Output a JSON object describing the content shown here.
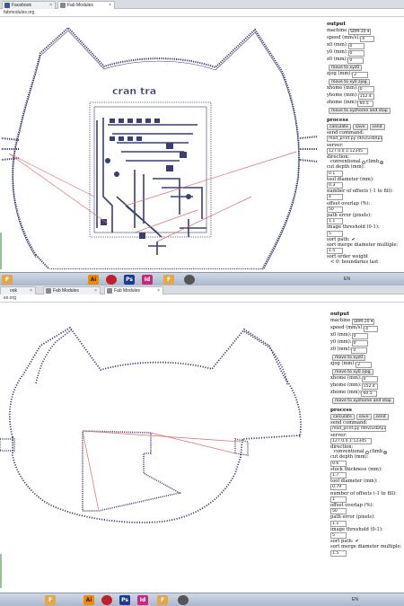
{
  "top": {
    "tabs": [
      {
        "label": "Facebook",
        "active": false
      },
      {
        "label": "Fab Modules",
        "active": true
      }
    ],
    "address": "fabmodules.org",
    "logo_text": "cran tra",
    "panel": {
      "output": "output",
      "machine_label": "machine",
      "machine_value": "SRM-20",
      "speed_label": "speed (mm/s):",
      "speed_value": "4",
      "x0_label": "x0 (mm):",
      "x0_value": "0",
      "y0_label": "y0 (mm):",
      "y0_value": "0",
      "z0_label": "z0 (mm):",
      "z0_value": "0",
      "move_xyz0": "move to xyz0",
      "zjog_label": "zjog (mm):",
      "zjog_value": "2",
      "move_xyzjog": "move to xy0 zjog",
      "xhome_label": "xhome (mm):",
      "xhome_value": "0",
      "yhome_label": "yhome (mm):",
      "yhome_value": "152.4",
      "zhome_label": "zhome (mm):",
      "zhome_value": "60.5",
      "move_home": "move to xyzhome and stop",
      "process": "process",
      "calculate": "calculate",
      "save": "save",
      "send": "send",
      "send_cmd_label": "send command:",
      "send_cmd_value": "mod_print.py /dev/usb/lp1 ;",
      "server_label": "server:",
      "server_value": "127.0.0.1:12345",
      "direction_label": "direction:",
      "conventional": "conventional",
      "climb": "climb",
      "cut_depth_label": "cut depth (mm):",
      "cut_depth_value": "0.1",
      "tool_dia_label": "tool diameter (mm):",
      "tool_dia_value": "0.3",
      "offsets_label": "number of offsets (-1 to fill):",
      "offsets_value": "4",
      "overlap_label": "offset overlap (%):",
      "overlap_value": "50",
      "path_err_label": "path error (pixels):",
      "path_err_value": "1.1",
      "threshold_label": "image threshold (0-1):",
      "threshold_value": "5",
      "sort_path": "sort path:",
      "sort_merge_label": "sort merge diameter multiple:",
      "sort_merge_value": "1.5",
      "sort_order_label": "sort order weight",
      "sort_order_note": "< 0: boundaries last"
    }
  },
  "bottom": {
    "tabs": [
      {
        "label": "ook",
        "active": false
      },
      {
        "label": "Fab Modules",
        "active": false
      },
      {
        "label": "Fab Modules",
        "active": true
      }
    ],
    "address": "es.org",
    "panel": {
      "output": "output",
      "machine_label": "machine",
      "machine_value": "SRM-20",
      "speed_label": "speed (mm/s):",
      "speed_value": "4",
      "x0_label": "x0 (mm):",
      "x0_value": "0",
      "y0_label": "y0 (mm):",
      "y0_value": "0",
      "z0_label": "z0 (mm):",
      "z0_value": "0",
      "move_xyz0": "move to xyz0",
      "zjog_label": "zjog (mm):",
      "zjog_value": "2",
      "move_xyzjog": "move to xy0 zjog",
      "xhome_label": "xhome (mm):",
      "xhome_value": "0",
      "yhome_label": "yhome (mm):",
      "yhome_value": "152.4",
      "zhome_label": "zhome (mm):",
      "zhome_value": "60.5",
      "move_home": "move to xyzhome and stop",
      "process": "process",
      "calculate": "calculate",
      "save": "save",
      "send": "send",
      "send_cmd_label": "send command:",
      "send_cmd_value": "mod_print.py /dev/usb/lp1 ;",
      "server_label": "server:",
      "server_value": "127.0.0.1:12345",
      "direction_label": "direction:",
      "conventional": "conventional",
      "climb": "climb",
      "cut_depth_label": "cut depth (mm):",
      "cut_depth_value": "0.6",
      "stock_label": "stock thickness (mm):",
      "stock_value": "1.7",
      "tool_dia_label": "tool diameter (mm):",
      "tool_dia_value": "0.79",
      "offsets_label": "number of offsets (-1 to fill):",
      "offsets_value": "1",
      "overlap_label": "offset overlap (%):",
      "overlap_value": "50",
      "path_err_label": "path error (pixels):",
      "path_err_value": "1.1",
      "threshold_label": "image threshold (0-1):",
      "threshold_value": "5",
      "sort_path": "sort path:",
      "sort_merge_label": "sort merge diameter multiple:",
      "sort_merge_value": "1.5"
    }
  },
  "taskbar_icons": [
    "F",
    "Ai",
    "Ps",
    "Id",
    "F"
  ],
  "lang": "EN",
  "colors": {
    "toolpath": "#3a3f72",
    "traverse": "#e06a6a",
    "illustrator": "#f08a00",
    "photoshop": "#1f3a8a",
    "indesign": "#c8287c"
  }
}
